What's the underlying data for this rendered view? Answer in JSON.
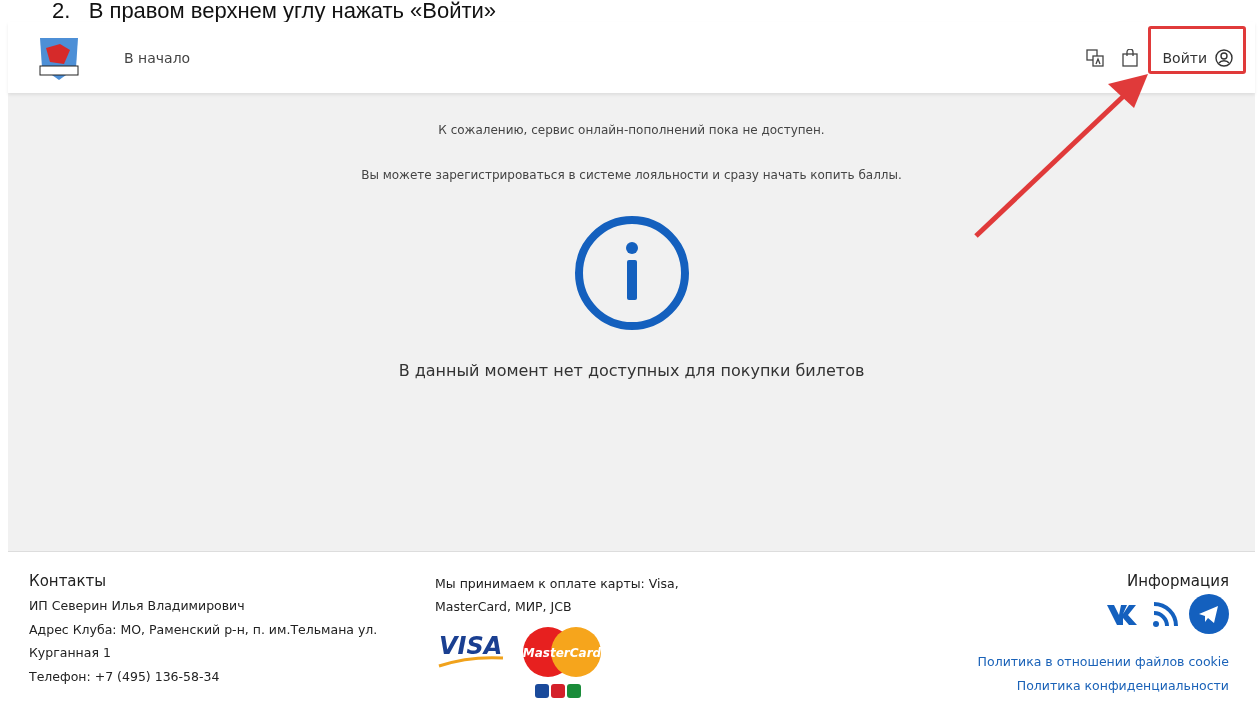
{
  "caption": "2.   В правом верхнем углу нажать «Войти»",
  "header": {
    "home_link": "В начало",
    "login": "Войти"
  },
  "notices": [
    "К сожалению, сервис онлайн-пополнений пока не доступен.",
    "Вы можете зарегистрироваться в системе лояльности и сразу начать копить баллы."
  ],
  "empty_message": "В данный момент нет доступных для покупки билетов",
  "footer": {
    "contacts": {
      "title": "Контакты",
      "lines": [
        "ИП Северин Илья Владимирович",
        "Адрес Клуба: МО, Раменский р-н, п. им.Тельмана ул.",
        "Курганная 1",
        "Телефон: +7 (495) 136-58-34"
      ]
    },
    "payment": {
      "text": "Мы принимаем к оплате карты: Visa, MasterCard, МИР, JCB",
      "cards": [
        {
          "kind": "visa",
          "label": "VISA"
        },
        {
          "kind": "mastercard",
          "label": "MasterCard"
        },
        {
          "kind": "jcb"
        }
      ]
    },
    "info": {
      "title": "Информация",
      "links": [
        "Политика в отношении файлов cookie",
        "Политика конфиденциальности"
      ]
    }
  }
}
